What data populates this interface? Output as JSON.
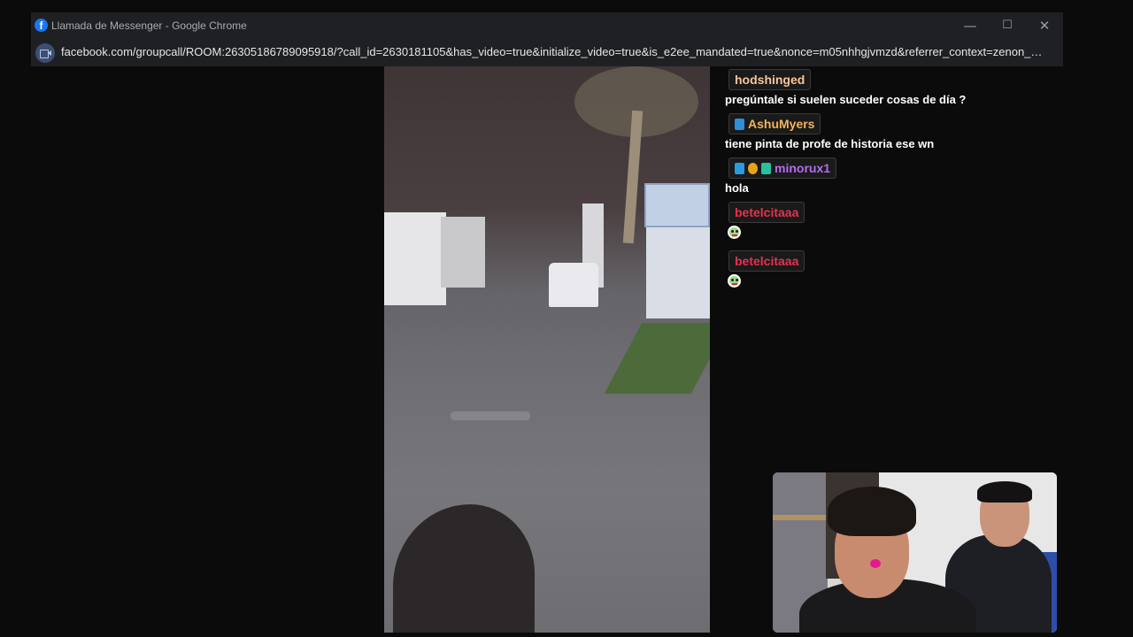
{
  "window": {
    "title": "Llamada de Messenger - Google Chrome",
    "favicon_letter": "f",
    "controls": {
      "minimize": "—",
      "maximize": "☐",
      "close": "✕"
    },
    "url": "facebook.com/groupcall/ROOM:2630518678909591​8/?call_id=2630181105&has_video=true&initialize_video=true&is_e2ee_mandated=true&nonce=m05nhhgjvmzd&referrer_context=zenon_prec..."
  },
  "chat": {
    "messages": [
      {
        "user": "hodshinged",
        "user_color": "#f5c69b",
        "text": "pregúntale si suelen suceder cosas de día ?"
      },
      {
        "user": "AshuMyers",
        "user_color": "#f3b35a",
        "text": "tiene pinta de profe de historia ese wn",
        "badges": [
          "prime-badge"
        ]
      },
      {
        "user": "minorux1",
        "user_color": "#b36df0",
        "text": "hola",
        "badges": [
          "cube-badge",
          "coin-badge",
          "glitch-badge"
        ]
      },
      {
        "user": "betelcitaaa",
        "user_color": "#e3334e",
        "emote": "frog-emote"
      },
      {
        "user": "betelcitaaa",
        "user_color": "#e3334e",
        "emote": "frog-emote"
      }
    ]
  }
}
